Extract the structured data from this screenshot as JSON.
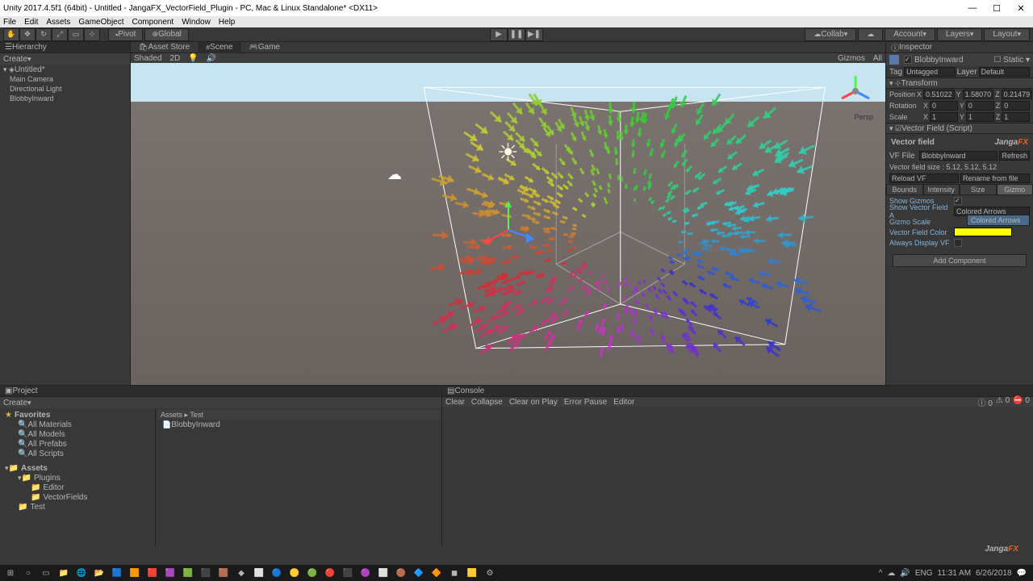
{
  "titlebar": "Unity 2017.4.5f1 (64bit) - Untitled - JangaFX_VectorField_Plugin - PC, Mac & Linux Standalone* <DX11>",
  "menubar": [
    "File",
    "Edit",
    "Assets",
    "GameObject",
    "Component",
    "Window",
    "Help"
  ],
  "toolbar": {
    "pivot": "Pivot",
    "global": "Global",
    "collab": "Collab",
    "account": "Account",
    "layers": "Layers",
    "layout": "Layout"
  },
  "hierarchy": {
    "title": "Hierarchy",
    "create": "Create",
    "scene": "Untitled*",
    "items": [
      "Main Camera",
      "Directional Light",
      "BlobbyInward"
    ]
  },
  "scene": {
    "tabs": {
      "asset_store": "Asset Store",
      "scene": "Scene",
      "game": "Game"
    },
    "toolbar": {
      "shaded": "Shaded",
      "mode2d": "2D",
      "gizmos": "Gizmos",
      "all": "All"
    },
    "persp": "Persp"
  },
  "inspector": {
    "title": "Inspector",
    "object_name": "BlobbyInward",
    "static_label": "Static",
    "tag_label": "Tag",
    "tag_value": "Untagged",
    "layer_label": "Layer",
    "layer_value": "Default",
    "transform": {
      "title": "Transform",
      "position": {
        "label": "Position",
        "x": "0.51022",
        "y": "1.58070",
        "z": "0.21479"
      },
      "rotation": {
        "label": "Rotation",
        "x": "0",
        "y": "0",
        "z": "0"
      },
      "scale": {
        "label": "Scale",
        "x": "1",
        "y": "1",
        "z": "1"
      }
    },
    "vf_script": {
      "header": "Vector Field (Script)",
      "title": "Vector field",
      "brand": "Janga",
      "brand_fx": "FX",
      "vf_file_label": "VF File",
      "vf_file_value": "BlobbyInward",
      "refresh": "Refresh",
      "size_text": "Vector field size : 5.12, 5.12, 5.12",
      "reload": "Reload VF",
      "rename": "Rename from file",
      "subtabs": {
        "bounds": "Bounds",
        "intensity": "Intensity",
        "size": "Size",
        "gizmo": "Gizmo"
      },
      "show_gizmos": "Show Gizmos",
      "show_as": "Show Vector Field A",
      "show_as_value": "Colored Arrows",
      "dropdown_option": "Colored Arrows",
      "gizmo_scale": "Gizmo Scale",
      "vf_color": "Vector Field Color",
      "always_display": "Always Display VF"
    },
    "add_component": "Add Component"
  },
  "project": {
    "title": "Project",
    "create": "Create",
    "favorites": "Favorites",
    "fav_items": [
      "All Materials",
      "All Models",
      "All Prefabs",
      "All Scripts"
    ],
    "assets": "Assets",
    "assets_tree": {
      "plugins": "Plugins",
      "editor": "Editor",
      "vectorfields": "VectorFields",
      "test": "Test"
    },
    "breadcrumb": "Assets ▸ Test",
    "files": [
      "BlobbyInward"
    ]
  },
  "console": {
    "title": "Console",
    "toolbar": {
      "clear": "Clear",
      "collapse": "Collapse",
      "clear_play": "Clear on Play",
      "error_pause": "Error Pause",
      "editor": "Editor"
    }
  },
  "watermark": {
    "janga": "Janga",
    "fx": "FX"
  },
  "taskbar": {
    "time": "11:31 AM",
    "date": "6/26/2018",
    "lang": "ENG"
  }
}
